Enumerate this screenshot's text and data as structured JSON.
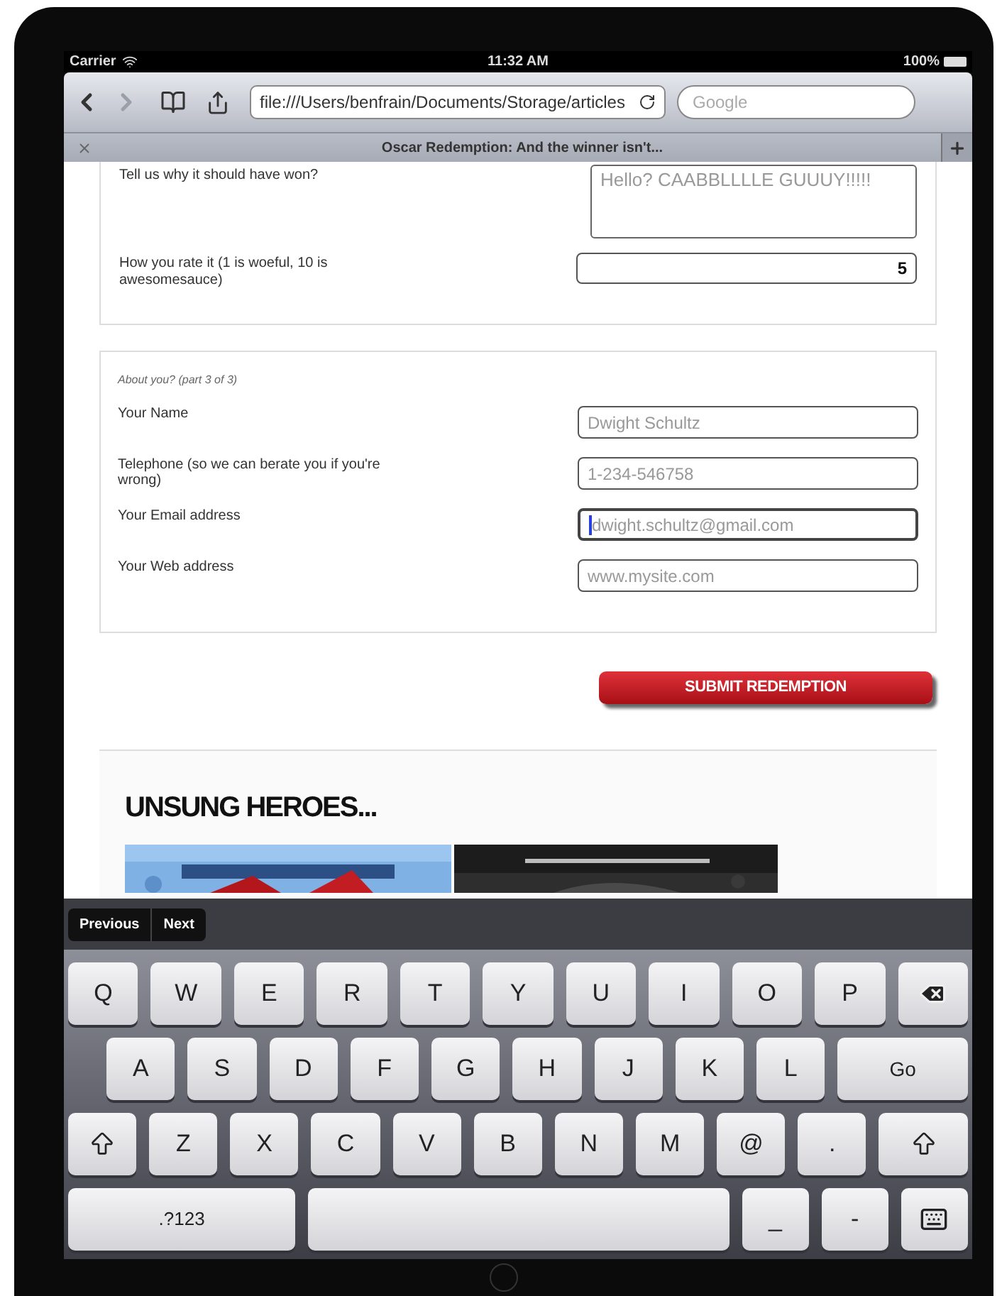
{
  "status_bar": {
    "carrier": "Carrier",
    "time": "11:32 AM",
    "battery": "100%"
  },
  "toolbar": {
    "back": {
      "disabled": false
    },
    "forward": {
      "disabled": true
    },
    "url": "file:///Users/benfrain/Documents/Storage/articles",
    "search": {
      "placeholder": "Google"
    }
  },
  "tab": {
    "title": "Oscar Redemption: And the winner isn't..."
  },
  "section_1": {
    "fields": [
      {
        "label": "Tell us why it should have won?",
        "kind": "textarea",
        "placeholder": "Hello? CAABBLLLLE GUUUY!!!!!"
      },
      {
        "label": "How you rate it (1 is woeful, 10 is awesomesauce)",
        "kind": "number",
        "value": "5"
      }
    ]
  },
  "section_2": {
    "legend": "About you? (part 3 of 3)",
    "fields": [
      {
        "label": "Your Name",
        "placeholder": "Dwight Schultz",
        "focused": false
      },
      {
        "label": "Telephone (so we can berate you if you're wrong)",
        "placeholder": "1-234-546758",
        "focused": false
      },
      {
        "label": "Your Email address",
        "placeholder": "dwight.schultz@gmail.com",
        "focused": true
      },
      {
        "label": "Your Web address",
        "placeholder": "www.mysite.com",
        "focused": false
      }
    ]
  },
  "submit": "SUBMIT REDEMPTION",
  "heroes": {
    "heading": "UNSUNG HEROES..."
  },
  "form_bar": {
    "buttons": [
      "Previous",
      "Next"
    ]
  },
  "keyboard": {
    "key_rows": [
      [
        {
          "kind": "letter",
          "label": "Q"
        },
        {
          "kind": "letter",
          "label": "W"
        },
        {
          "kind": "letter",
          "label": "E"
        },
        {
          "kind": "letter",
          "label": "R"
        },
        {
          "kind": "letter",
          "label": "T"
        },
        {
          "kind": "letter",
          "label": "Y"
        },
        {
          "kind": "letter",
          "label": "U"
        },
        {
          "kind": "letter",
          "label": "I"
        },
        {
          "kind": "letter",
          "label": "O"
        },
        {
          "kind": "letter",
          "label": "P"
        },
        {
          "kind": "backspace"
        }
      ],
      [
        {
          "kind": "letter",
          "label": "A"
        },
        {
          "kind": "letter",
          "label": "S"
        },
        {
          "kind": "letter",
          "label": "D"
        },
        {
          "kind": "letter",
          "label": "F"
        },
        {
          "kind": "letter",
          "label": "G"
        },
        {
          "kind": "letter",
          "label": "H"
        },
        {
          "kind": "letter",
          "label": "J"
        },
        {
          "kind": "letter",
          "label": "K"
        },
        {
          "kind": "letter",
          "label": "L"
        },
        {
          "kind": "return",
          "label": "Go"
        }
      ],
      [
        {
          "kind": "shift"
        },
        {
          "kind": "letter",
          "label": "Z"
        },
        {
          "kind": "letter",
          "label": "X"
        },
        {
          "kind": "letter",
          "label": "C"
        },
        {
          "kind": "letter",
          "label": "V"
        },
        {
          "kind": "letter",
          "label": "B"
        },
        {
          "kind": "letter",
          "label": "N"
        },
        {
          "kind": "letter",
          "label": "M"
        },
        {
          "kind": "letter",
          "label": "@"
        },
        {
          "kind": "letter",
          "label": "."
        },
        {
          "kind": "shift"
        }
      ],
      [
        {
          "kind": "mode",
          "label": ".?123"
        },
        {
          "kind": "space"
        },
        {
          "kind": "letter",
          "label": "_"
        },
        {
          "kind": "letter",
          "label": "-"
        },
        {
          "kind": "hide"
        }
      ]
    ]
  }
}
